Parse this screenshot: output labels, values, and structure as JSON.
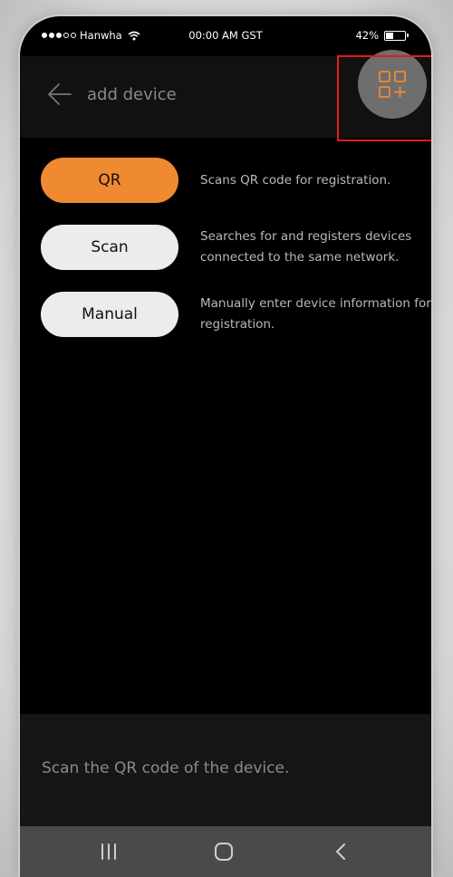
{
  "status_bar": {
    "carrier": "Hanwha",
    "time": "00:00 AM GST",
    "battery_percent": "42%",
    "battery_level": 0.42
  },
  "header": {
    "title": "add device",
    "back_icon": "arrow-left-icon",
    "qr_add_icon": "qr-add-icon"
  },
  "options": [
    {
      "label": "QR",
      "description_lines": [
        "Scans QR code for registration."
      ]
    },
    {
      "label": "Scan",
      "description_lines": [
        "Searches for and registers devices",
        "connected to the same network."
      ]
    },
    {
      "label": "Manual",
      "description_lines": [
        "Manually enter device information for",
        "registration."
      ]
    }
  ],
  "hint": {
    "text": "Scan the QR code of the device."
  },
  "nav_bar": {
    "recents_icon": "recents-icon",
    "home_icon": "home-icon",
    "back_icon": "chevron-left-icon"
  },
  "colors": {
    "accent": "#f08a32",
    "highlight": "#e41b1b"
  }
}
